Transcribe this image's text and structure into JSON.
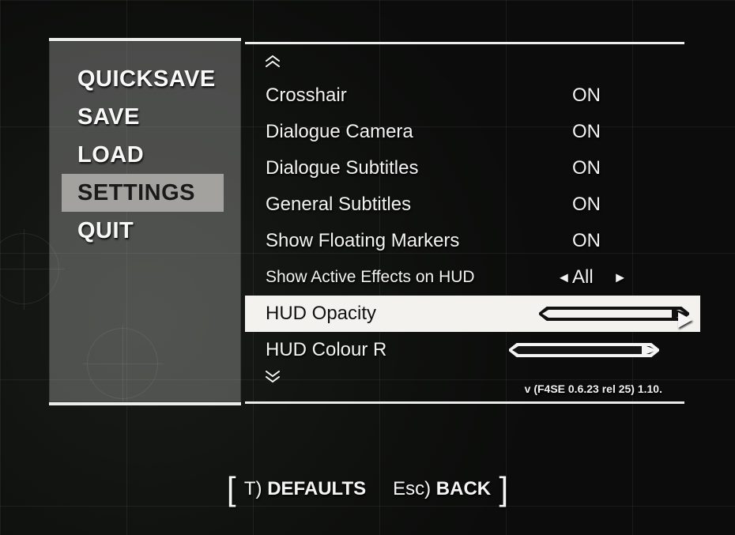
{
  "menu": {
    "items": [
      {
        "label": "QUICKSAVE",
        "selected": false
      },
      {
        "label": "SAVE",
        "selected": false
      },
      {
        "label": "LOAD",
        "selected": false
      },
      {
        "label": "SETTINGS",
        "selected": true
      },
      {
        "label": "QUIT",
        "selected": false
      }
    ]
  },
  "settings": {
    "rows": [
      {
        "label": "Crosshair",
        "value": "ON",
        "type": "toggle"
      },
      {
        "label": "Dialogue Camera",
        "value": "ON",
        "type": "toggle"
      },
      {
        "label": "Dialogue Subtitles",
        "value": "ON",
        "type": "toggle"
      },
      {
        "label": "General Subtitles",
        "value": "ON",
        "type": "toggle"
      },
      {
        "label": "Show Floating Markers",
        "value": "ON",
        "type": "toggle"
      },
      {
        "label": "Show Active Effects on HUD",
        "value": "All",
        "type": "enum",
        "arrows": true
      },
      {
        "label": "HUD Opacity",
        "value": 1.0,
        "type": "slider",
        "fill": 1.0,
        "highlight": true
      },
      {
        "label": "HUD Colour R",
        "value": 1.0,
        "type": "slider",
        "fill": 1.0
      }
    ],
    "scroll_above": true,
    "scroll_below": true
  },
  "version": "v (F4SE 0.6.23 rel 25) 1.10.",
  "hints": {
    "defaults_key": "T)",
    "defaults_label": "DEFAULTS",
    "back_key": "Esc)",
    "back_label": "BACK"
  },
  "icons": {
    "chevrons_up": "︿\n︿",
    "chevrons_down": "﹀\n﹀",
    "tri_left": "◀",
    "tri_right": "▶"
  },
  "colors": {
    "panel_border": "#ececec",
    "highlight_bg": "#f3f2ef",
    "text_light": "#f2f2f2",
    "text_dark": "#111111"
  }
}
